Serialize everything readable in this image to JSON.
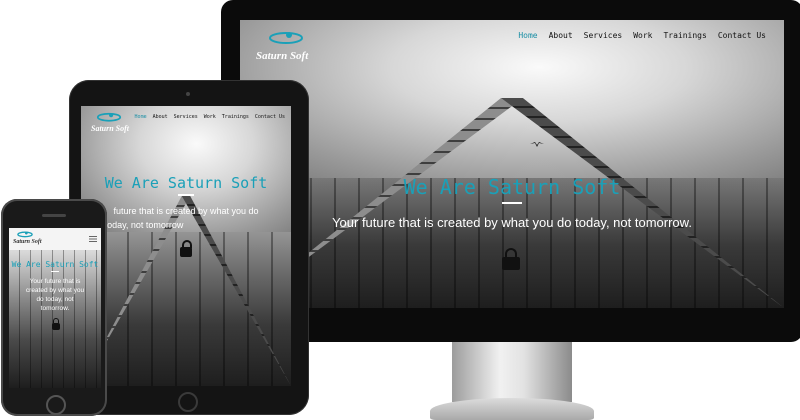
{
  "brand": {
    "name": "Saturn Soft"
  },
  "nav": {
    "items": [
      "Home",
      "About",
      "Services",
      "Work",
      "Trainings",
      "Contact Us"
    ],
    "active": "Home"
  },
  "hero": {
    "title": "We Are Saturn Soft",
    "subtitle": "Your future that is created by what you do today, not tomorrow.",
    "subtitle_tablet_lines": [
      "future that is created by what you do",
      "today, not tomorrow"
    ],
    "subtitle_phone_lines": [
      "Your future that is",
      "created by what you",
      "do today, not",
      "tomorrow."
    ]
  },
  "colors": {
    "accent": "#1b8fa5",
    "title": "#1aa0b8",
    "bezel": "#0b0b0b"
  },
  "icons": [
    "saturn-logo-icon",
    "lock-icon",
    "bird-icon",
    "menu-icon"
  ]
}
